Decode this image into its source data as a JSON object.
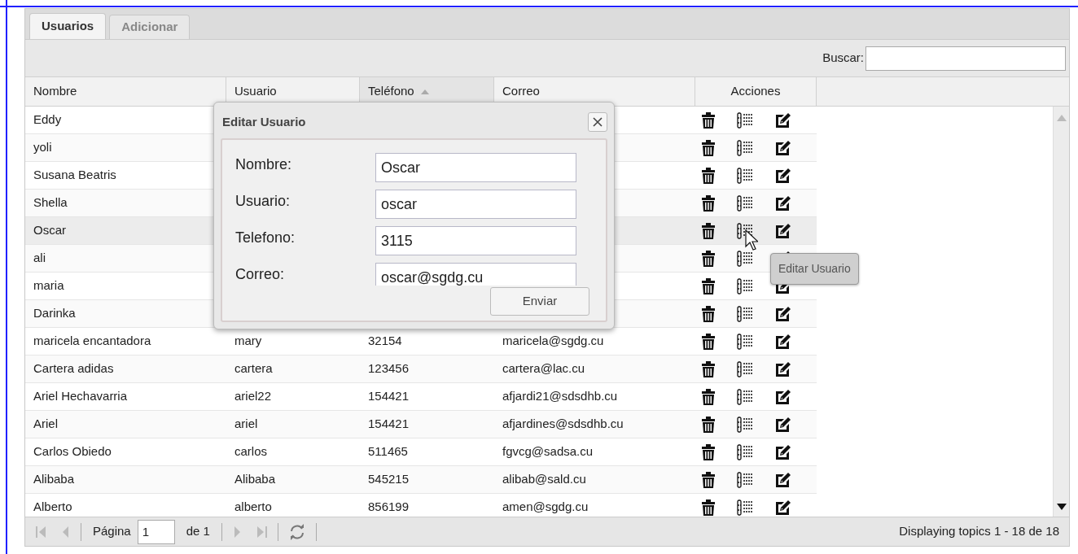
{
  "tabs": [
    {
      "label": "Usuarios",
      "selected": true
    },
    {
      "label": "Adicionar",
      "selected": false
    }
  ],
  "search": {
    "label": "Buscar:"
  },
  "table": {
    "columns": [
      {
        "label": "Nombre",
        "sorted": false
      },
      {
        "label": "Usuario",
        "sorted": false
      },
      {
        "label": "Teléfono",
        "sorted": true
      },
      {
        "label": "Correo",
        "sorted": false
      },
      {
        "label": "Acciones",
        "sorted": false
      }
    ],
    "rows": [
      {
        "nombre": "Eddy",
        "selected": false
      },
      {
        "nombre": "yoli",
        "selected": false
      },
      {
        "nombre": "Susana Beatris",
        "selected": false
      },
      {
        "nombre": "Shella",
        "selected": false
      },
      {
        "nombre": "Oscar",
        "selected": true
      },
      {
        "nombre": "ali",
        "selected": false
      },
      {
        "nombre": "maria",
        "selected": false
      },
      {
        "nombre": "Darinka",
        "selected": false
      },
      {
        "nombre": "maricela encantadora",
        "usuario": "mary",
        "telefono": "32154",
        "correo": "maricela@sgdg.cu",
        "selected": false
      },
      {
        "nombre": "Cartera adidas",
        "usuario": "cartera",
        "telefono": "123456",
        "correo": "cartera@lac.cu",
        "selected": false
      },
      {
        "nombre": "Ariel Hechavarria",
        "usuario": "ariel22",
        "telefono": "154421",
        "correo": "afjardi21@sdsdhb.cu",
        "selected": false
      },
      {
        "nombre": "Ariel",
        "usuario": "ariel",
        "telefono": "154421",
        "correo": "afjardines@sdsdhb.cu",
        "selected": false
      },
      {
        "nombre": "Carlos Obiedo",
        "usuario": "carlos",
        "telefono": "511465",
        "correo": "fgvcg@sadsa.cu",
        "selected": false
      },
      {
        "nombre": "Alibaba",
        "usuario": "Alibaba",
        "telefono": "545215",
        "correo": "alibab@sald.cu",
        "selected": false
      },
      {
        "nombre": "Alberto",
        "usuario": "alberto",
        "telefono": "856199",
        "correo": "amen@sgdg.cu",
        "selected": false
      }
    ]
  },
  "dialog": {
    "title": "Editar Usuario",
    "fields": [
      {
        "label": "Nombre:",
        "value": "Oscar"
      },
      {
        "label": "Usuario:",
        "value": "oscar"
      },
      {
        "label": "Telefono:",
        "value": "3115"
      },
      {
        "label": "Correo:",
        "value": "oscar@sgdg.cu"
      }
    ],
    "submit": "Enviar"
  },
  "tooltip": "Editar Usuario",
  "pager": {
    "page_label": "Página",
    "page": "1",
    "of": "de 1",
    "summary": "Displaying topics 1 - 18 de 18"
  }
}
